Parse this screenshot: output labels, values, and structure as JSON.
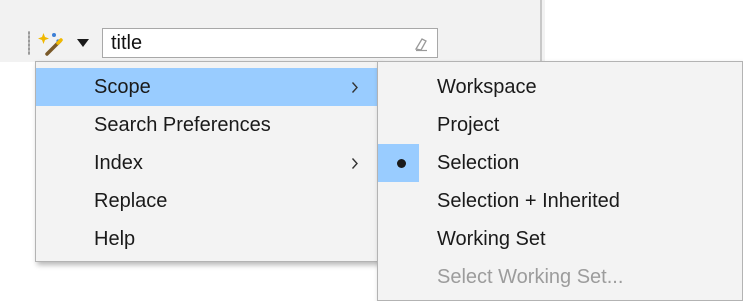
{
  "search": {
    "value": "title"
  },
  "main_menu": {
    "items": [
      {
        "label": "Scope",
        "has_submenu": true,
        "highlighted": true
      },
      {
        "label": "Search Preferences",
        "has_submenu": false
      },
      {
        "label": "Index",
        "has_submenu": true
      },
      {
        "label": "Replace",
        "has_submenu": false
      },
      {
        "label": "Help",
        "has_submenu": false
      }
    ]
  },
  "scope_menu": {
    "items": [
      {
        "label": "Workspace",
        "enabled": true
      },
      {
        "label": "Project",
        "enabled": true
      },
      {
        "label": "Selection",
        "enabled": true,
        "selected": true
      },
      {
        "label": "Selection + Inherited",
        "enabled": true
      },
      {
        "label": "Working Set",
        "enabled": true
      },
      {
        "label": "Select Working Set...",
        "enabled": false
      }
    ]
  },
  "colors": {
    "highlight": "#99ccff",
    "menu_background": "#f3f3f3",
    "toolbar_background": "#f2f2f2",
    "disabled_text": "#9c9c9c"
  },
  "icons": {
    "search_tool": "magic-wand-icon",
    "dropdown": "dropdown-arrow-icon",
    "clear": "eraser-icon",
    "submenu": "chevron-right-icon",
    "radio": "radio-selected-icon"
  }
}
